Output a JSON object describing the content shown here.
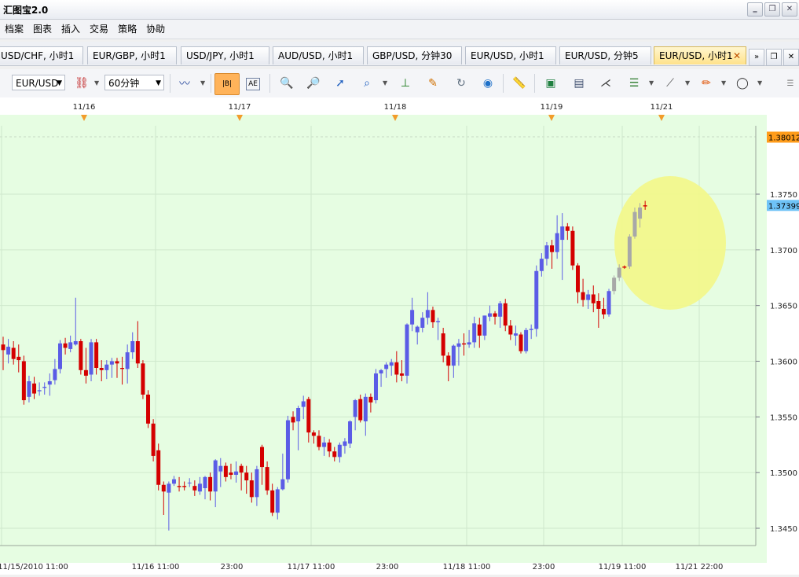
{
  "app": {
    "title": "汇图宝2.0"
  },
  "window_controls": {
    "minimize": "‗",
    "restore": "❐",
    "close": "✕"
  },
  "menu": [
    "档案",
    "图表",
    "插入",
    "交易",
    "策略",
    "协助"
  ],
  "tabs": [
    {
      "label": "USD/CHF, 小时1",
      "active": false
    },
    {
      "label": "EUR/GBP, 小时1",
      "active": false
    },
    {
      "label": "USD/JPY, 小时1",
      "active": false
    },
    {
      "label": "AUD/USD, 小时1",
      "active": false
    },
    {
      "label": "GBP/USD, 分钟30",
      "active": false
    },
    {
      "label": "EUR/USD, 小时1",
      "active": false
    },
    {
      "label": "EUR/USD, 分钟5",
      "active": false
    },
    {
      "label": "EUR/USD, 小时1",
      "active": true
    }
  ],
  "tab_close": "✕",
  "tab_scroll": "»",
  "toolbar": {
    "symbol": "EUR/USD",
    "timeframe": "60分钟",
    "icons": [
      "indicator-icon",
      "bar-chart-icon",
      "candle-icon",
      "chart-settings-icon",
      "zoom-in-icon",
      "zoom-out-icon",
      "pointer-icon",
      "magnifier-icon",
      "trade-icon",
      "edit-icon",
      "sync-icon",
      "globe-icon",
      "ruler-icon",
      "picture-icon",
      "template-icon",
      "fork-icon",
      "list-icon",
      "pen-icon",
      "brush-icon",
      "ellipse-icon"
    ]
  },
  "chart_data": {
    "type": "candlestick",
    "symbol": "EUR/USD",
    "y_ticks": [
      "1.3750",
      "1.3700",
      "1.3650",
      "1.3600",
      "1.3550",
      "1.3500",
      "1.3450"
    ],
    "y_range": [
      1.3415,
      1.3822
    ],
    "price_tags": [
      {
        "label": "1.38012",
        "color": "#ff9c1a"
      },
      {
        "label": "1.37399",
        "color": "#6ec3f7"
      }
    ],
    "top_dates": [
      "11/16",
      "11/17",
      "11/18",
      "11/19",
      "11/21"
    ],
    "x_labels": [
      "11/15/2010 11:00",
      "11/16 11:00",
      "23:00",
      "11/17 11:00",
      "23:00",
      "11/18 11:00",
      "23:00",
      "11/19 11:00",
      "11/21 22:00"
    ],
    "colors": {
      "up": "#5b5ce6",
      "down": "#d40000",
      "highlight_up": "#a8a8a8",
      "background": "#e6fde2",
      "grid": "#cfe8cc",
      "highlight": "#f3f78a"
    },
    "candles": [
      [
        1.3615,
        1.361,
        1.3622,
        1.3592,
        "down"
      ],
      [
        1.3606,
        1.3613,
        1.362,
        1.3598,
        "up"
      ],
      [
        1.3612,
        1.3602,
        1.3618,
        1.3597,
        "down"
      ],
      [
        1.3604,
        1.3601,
        1.3615,
        1.359,
        "down"
      ],
      [
        1.36,
        1.3565,
        1.3605,
        1.3561,
        "down"
      ],
      [
        1.3568,
        1.3582,
        1.3587,
        1.3563,
        "up"
      ],
      [
        1.358,
        1.3571,
        1.3586,
        1.3566,
        "down"
      ],
      [
        1.3573,
        1.3574,
        1.3581,
        1.3569,
        "up"
      ],
      [
        1.3576,
        1.3577,
        1.3581,
        1.357,
        "up"
      ],
      [
        1.3579,
        1.3582,
        1.3589,
        1.3569,
        "up"
      ],
      [
        1.3583,
        1.3593,
        1.3602,
        1.3579,
        "up"
      ],
      [
        1.3593,
        1.3616,
        1.3619,
        1.3589,
        "up"
      ],
      [
        1.3616,
        1.3612,
        1.3621,
        1.3606,
        "down"
      ],
      [
        1.3611,
        1.3617,
        1.3623,
        1.3608,
        "up"
      ],
      [
        1.3615,
        1.3618,
        1.3657,
        1.3614,
        "up"
      ],
      [
        1.3618,
        1.3592,
        1.362,
        1.3588,
        "down"
      ],
      [
        1.3592,
        1.3587,
        1.3612,
        1.358,
        "down"
      ],
      [
        1.3588,
        1.3617,
        1.362,
        1.3582,
        "up"
      ],
      [
        1.3617,
        1.3594,
        1.362,
        1.3588,
        "down"
      ],
      [
        1.3594,
        1.3592,
        1.3601,
        1.3582,
        "down"
      ],
      [
        1.3592,
        1.3597,
        1.3601,
        1.3584,
        "up"
      ],
      [
        1.3597,
        1.36,
        1.3603,
        1.3585,
        "up"
      ],
      [
        1.36,
        1.3598,
        1.3603,
        1.3585,
        "down"
      ],
      [
        1.3594,
        1.3593,
        1.3604,
        1.3579,
        "down"
      ],
      [
        1.3593,
        1.3608,
        1.3615,
        1.358,
        "up"
      ],
      [
        1.3608,
        1.3618,
        1.3626,
        1.3602,
        "up"
      ],
      [
        1.3618,
        1.3598,
        1.3636,
        1.3594,
        "down"
      ],
      [
        1.3598,
        1.357,
        1.3601,
        1.3566,
        "down"
      ],
      [
        1.357,
        1.3544,
        1.3574,
        1.354,
        "down"
      ],
      [
        1.3544,
        1.3515,
        1.3548,
        1.351,
        "down"
      ],
      [
        1.352,
        1.3489,
        1.3526,
        1.3484,
        "down"
      ],
      [
        1.3489,
        1.3483,
        1.3492,
        1.3462,
        "down"
      ],
      [
        1.3482,
        1.349,
        1.3492,
        1.3448,
        "up"
      ],
      [
        1.349,
        1.3494,
        1.3497,
        1.3488,
        "up"
      ],
      [
        1.3487,
        1.3488,
        1.3496,
        1.3483,
        "down"
      ],
      [
        1.3488,
        1.3487,
        1.3492,
        1.3484,
        "down"
      ],
      [
        1.3491,
        1.3491,
        1.3495,
        1.3487,
        "up"
      ],
      [
        1.3488,
        1.3484,
        1.3493,
        1.3479,
        "down"
      ],
      [
        1.3483,
        1.349,
        1.3496,
        1.348,
        "up"
      ],
      [
        1.3486,
        1.3496,
        1.3497,
        1.3476,
        "up"
      ],
      [
        1.3496,
        1.3483,
        1.35,
        1.3475,
        "down"
      ],
      [
        1.3483,
        1.3511,
        1.3512,
        1.3469,
        "up"
      ],
      [
        1.3501,
        1.3506,
        1.3513,
        1.3487,
        "up"
      ],
      [
        1.3506,
        1.3496,
        1.3509,
        1.3492,
        "down"
      ],
      [
        1.35,
        1.3498,
        1.3508,
        1.3494,
        "down"
      ],
      [
        1.3498,
        1.3501,
        1.351,
        1.3491,
        "up"
      ],
      [
        1.3506,
        1.35,
        1.3508,
        1.3484,
        "down"
      ],
      [
        1.35,
        1.3493,
        1.3506,
        1.3481,
        "down"
      ],
      [
        1.3493,
        1.3478,
        1.35,
        1.3473,
        "down"
      ],
      [
        1.3478,
        1.3503,
        1.3506,
        1.347,
        "up"
      ],
      [
        1.3523,
        1.3505,
        1.3525,
        1.3489,
        "down"
      ],
      [
        1.3505,
        1.3484,
        1.351,
        1.348,
        "down"
      ],
      [
        1.3484,
        1.3464,
        1.349,
        1.3461,
        "down"
      ],
      [
        1.3464,
        1.3485,
        1.3487,
        1.3458,
        "up"
      ],
      [
        1.3485,
        1.3494,
        1.3517,
        1.3484,
        "up"
      ],
      [
        1.3494,
        1.3547,
        1.3551,
        1.3491,
        "up"
      ],
      [
        1.355,
        1.3545,
        1.3555,
        1.3538,
        "down"
      ],
      [
        1.3546,
        1.3558,
        1.356,
        1.352,
        "up"
      ],
      [
        1.3559,
        1.3564,
        1.3569,
        1.3548,
        "up"
      ],
      [
        1.3566,
        1.3536,
        1.3568,
        1.3527,
        "down"
      ],
      [
        1.3536,
        1.3533,
        1.3538,
        1.3526,
        "down"
      ],
      [
        1.3533,
        1.3523,
        1.3538,
        1.352,
        "down"
      ],
      [
        1.3523,
        1.3527,
        1.3532,
        1.3515,
        "up"
      ],
      [
        1.3527,
        1.3519,
        1.353,
        1.3514,
        "down"
      ],
      [
        1.3519,
        1.3514,
        1.3523,
        1.351,
        "down"
      ],
      [
        1.3514,
        1.3525,
        1.3527,
        1.3509,
        "up"
      ],
      [
        1.3524,
        1.3528,
        1.3531,
        1.3517,
        "up"
      ],
      [
        1.3526,
        1.3546,
        1.3547,
        1.3522,
        "up"
      ],
      [
        1.355,
        1.3565,
        1.3566,
        1.3538,
        "up"
      ],
      [
        1.3566,
        1.3547,
        1.357,
        1.3545,
        "down"
      ],
      [
        1.3546,
        1.3568,
        1.3571,
        1.3533,
        "up"
      ],
      [
        1.3568,
        1.3563,
        1.3571,
        1.3554,
        "down"
      ],
      [
        1.3565,
        1.3589,
        1.3593,
        1.3562,
        "up"
      ],
      [
        1.3589,
        1.3592,
        1.3593,
        1.3577,
        "up"
      ],
      [
        1.3593,
        1.3597,
        1.3599,
        1.3585,
        "up"
      ],
      [
        1.3596,
        1.3599,
        1.3602,
        1.3587,
        "up"
      ],
      [
        1.3599,
        1.3588,
        1.3609,
        1.3581,
        "down"
      ],
      [
        1.3589,
        1.3587,
        1.3601,
        1.3582,
        "down"
      ],
      [
        1.3587,
        1.3633,
        1.3634,
        1.358,
        "up"
      ],
      [
        1.3633,
        1.3646,
        1.3657,
        1.3627,
        "up"
      ],
      [
        1.3626,
        1.3631,
        1.3632,
        1.3615,
        "up"
      ],
      [
        1.363,
        1.3639,
        1.3644,
        1.3626,
        "up"
      ],
      [
        1.3639,
        1.3646,
        1.3662,
        1.3633,
        "up"
      ],
      [
        1.3646,
        1.3635,
        1.3649,
        1.363,
        "down"
      ],
      [
        1.3635,
        1.3636,
        1.3639,
        1.3619,
        "up"
      ],
      [
        1.3625,
        1.3605,
        1.363,
        1.3599,
        "down"
      ],
      [
        1.3605,
        1.3596,
        1.3608,
        1.3582,
        "down"
      ],
      [
        1.3596,
        1.3614,
        1.3615,
        1.3585,
        "up"
      ],
      [
        1.3613,
        1.3616,
        1.362,
        1.3596,
        "up"
      ],
      [
        1.3616,
        1.3615,
        1.3625,
        1.3605,
        "down"
      ],
      [
        1.3615,
        1.3617,
        1.3628,
        1.3612,
        "up"
      ],
      [
        1.3617,
        1.3634,
        1.364,
        1.3612,
        "up"
      ],
      [
        1.3633,
        1.3623,
        1.3639,
        1.3612,
        "down"
      ],
      [
        1.3623,
        1.3641,
        1.3641,
        1.3619,
        "up"
      ],
      [
        1.364,
        1.3643,
        1.365,
        1.3636,
        "up"
      ],
      [
        1.3643,
        1.364,
        1.3645,
        1.3633,
        "down"
      ],
      [
        1.364,
        1.3652,
        1.3654,
        1.363,
        "up"
      ],
      [
        1.3652,
        1.3632,
        1.3656,
        1.3627,
        "down"
      ],
      [
        1.3632,
        1.3624,
        1.3637,
        1.3619,
        "down"
      ],
      [
        1.3623,
        1.3625,
        1.3632,
        1.3614,
        "up"
      ],
      [
        1.3624,
        1.3609,
        1.3626,
        1.3607,
        "down"
      ],
      [
        1.3609,
        1.3628,
        1.363,
        1.3607,
        "up"
      ],
      [
        1.3628,
        1.3629,
        1.3633,
        1.362,
        "up"
      ],
      [
        1.3629,
        1.3681,
        1.3686,
        1.3622,
        "up"
      ],
      [
        1.3681,
        1.3692,
        1.3697,
        1.3676,
        "up"
      ],
      [
        1.3692,
        1.3704,
        1.3707,
        1.3686,
        "up"
      ],
      [
        1.3704,
        1.3698,
        1.3709,
        1.3683,
        "down"
      ],
      [
        1.3698,
        1.3715,
        1.3731,
        1.3692,
        "up"
      ],
      [
        1.3709,
        1.3721,
        1.3733,
        1.3673,
        "up"
      ],
      [
        1.3721,
        1.3717,
        1.3724,
        1.3709,
        "down"
      ],
      [
        1.3717,
        1.3686,
        1.3721,
        1.3682,
        "down"
      ],
      [
        1.3686,
        1.3662,
        1.3688,
        1.3652,
        "down"
      ],
      [
        1.3662,
        1.3655,
        1.3674,
        1.3649,
        "down"
      ],
      [
        1.3655,
        1.366,
        1.3664,
        1.3647,
        "up"
      ],
      [
        1.366,
        1.3652,
        1.3668,
        1.3644,
        "down"
      ],
      [
        1.3654,
        1.3647,
        1.3661,
        1.363,
        "down"
      ],
      [
        1.3647,
        1.3642,
        1.3657,
        1.3638,
        "down"
      ],
      [
        1.3642,
        1.3663,
        1.3665,
        1.364,
        "up"
      ],
      [
        1.3663,
        1.3675,
        1.3677,
        1.366,
        "hl"
      ],
      [
        1.3675,
        1.3684,
        1.3687,
        1.3672,
        "hl"
      ],
      [
        1.3685,
        1.3684,
        1.3686,
        1.3683,
        "down"
      ],
      [
        1.3685,
        1.3712,
        1.3714,
        1.3683,
        "hl"
      ],
      [
        1.3712,
        1.3734,
        1.3738,
        1.371,
        "hl"
      ],
      [
        1.3728,
        1.3738,
        1.3742,
        1.372,
        "hl"
      ],
      [
        1.3739,
        1.374,
        1.3744,
        1.3736,
        "down"
      ]
    ]
  }
}
